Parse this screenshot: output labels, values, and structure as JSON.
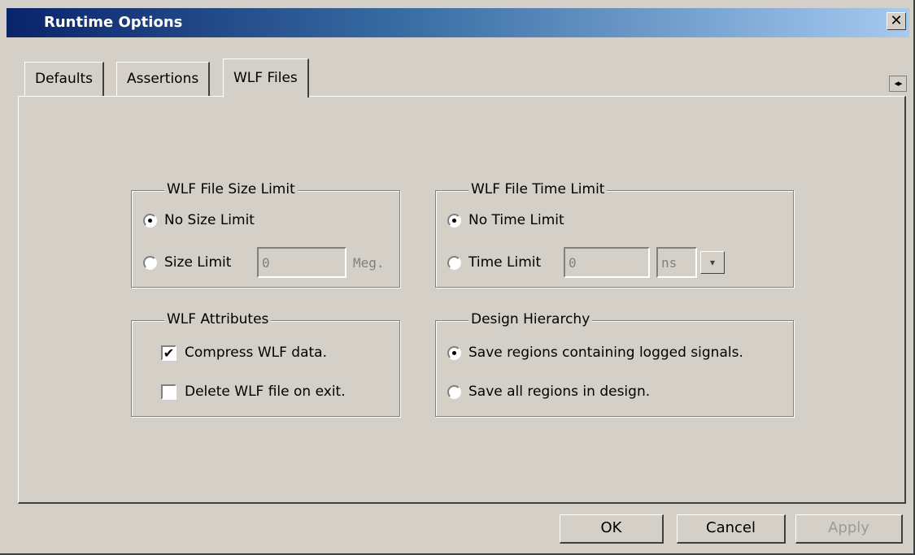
{
  "window": {
    "title": "Runtime Options",
    "close_glyph": "✕"
  },
  "tabs": [
    {
      "label": "Defaults",
      "active": false
    },
    {
      "label": "Assertions",
      "active": false
    },
    {
      "label": "WLF Files",
      "active": true
    }
  ],
  "tab_scroll": {
    "left": "◂",
    "right": "▸"
  },
  "size_limit": {
    "legend": "WLF File Size Limit",
    "no_limit_label": "No Size Limit",
    "limit_label": "Size Limit",
    "selected": "no_limit",
    "value": "0",
    "unit": "Meg."
  },
  "time_limit": {
    "legend": "WLF File Time Limit",
    "no_limit_label": "No Time Limit",
    "limit_label": "Time Limit",
    "selected": "no_limit",
    "value": "0",
    "unit": "ns",
    "dropdown_glyph": "▾"
  },
  "attributes": {
    "legend": "WLF Attributes",
    "compress_label": "Compress WLF data.",
    "compress_checked": true,
    "delete_label": "Delete WLF file on exit.",
    "delete_checked": false,
    "check_glyph": "✔"
  },
  "hierarchy": {
    "legend": "Design Hierarchy",
    "logged_label": "Save regions containing logged signals.",
    "all_label": "Save all regions in design.",
    "selected": "logged"
  },
  "buttons": {
    "ok": "OK",
    "cancel": "Cancel",
    "apply": "Apply"
  }
}
